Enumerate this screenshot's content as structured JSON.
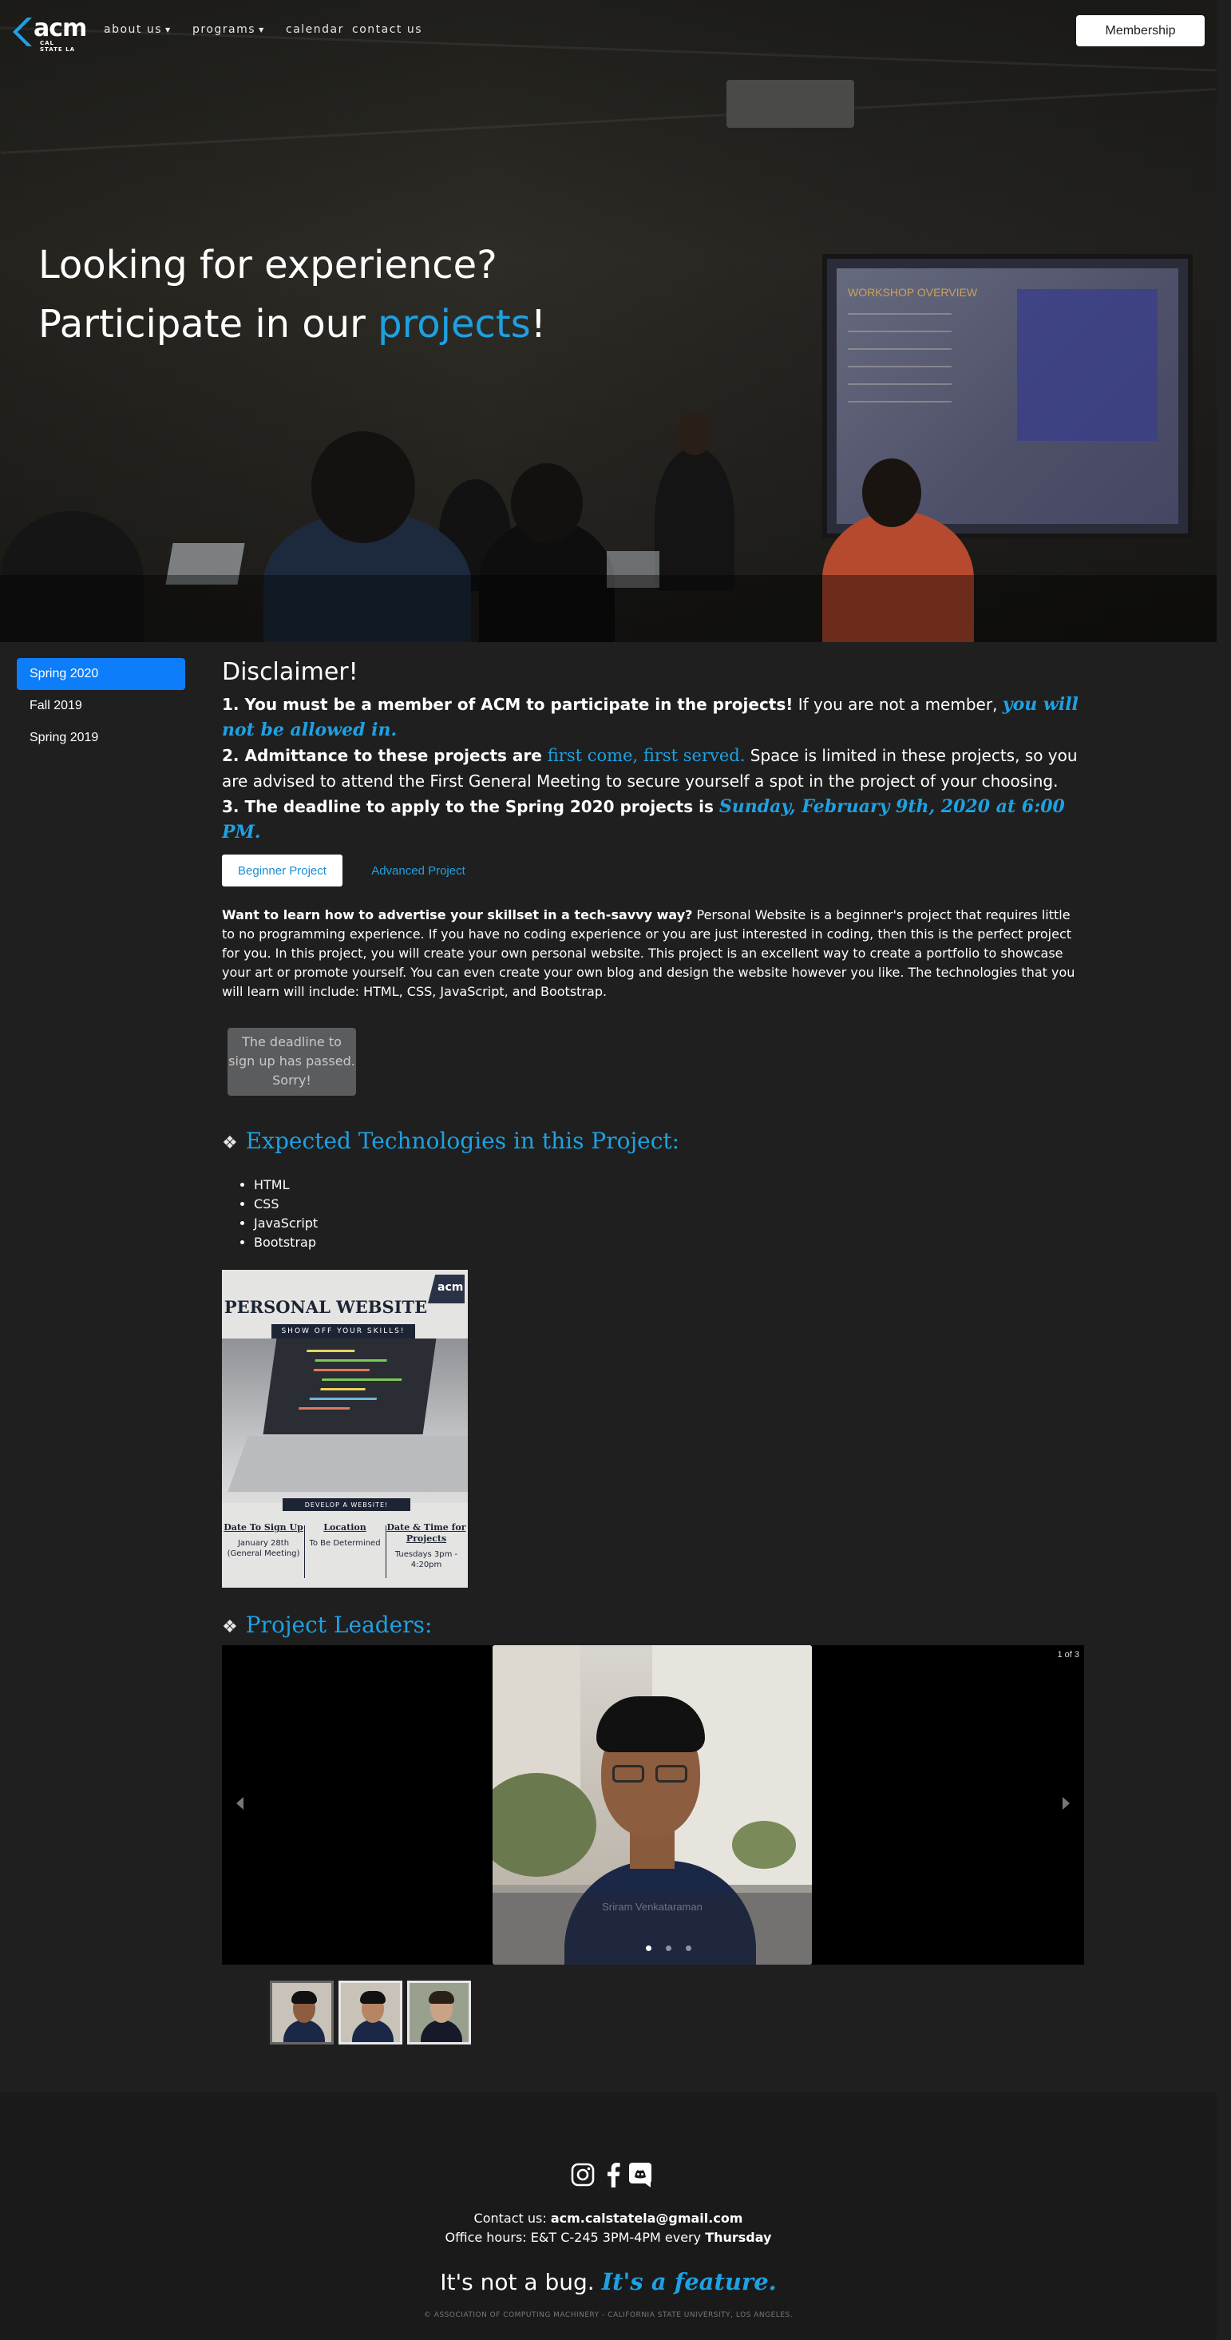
{
  "brand": {
    "logo_text": "acm",
    "logo_sub": "CAL STATE LA"
  },
  "nav": {
    "about": "about us",
    "programs": "programs",
    "calendar": "calendar",
    "contact": "contact us",
    "membership": "Membership"
  },
  "hero": {
    "line1": "Looking for experience?",
    "line2_prefix": "Participate in our ",
    "line2_accent": "projects",
    "line2_suffix": "!",
    "screen_title": "WORKSHOP OVERVIEW"
  },
  "sidebar": {
    "items": [
      {
        "label": "Spring 2020",
        "active": true
      },
      {
        "label": "Fall 2019",
        "active": false
      },
      {
        "label": "Spring 2019",
        "active": false
      }
    ]
  },
  "disclaimer": {
    "title": "Disclaimer!",
    "p1_bold": "1. You must be a member of ACM to participate in the projects!",
    "p1_text": " If you are not a member, ",
    "p1_accent": "you will not be allowed in.",
    "p2_bold": "2. Admittance to these projects are ",
    "p2_accent": "first come, first served.",
    "p2_text": " Space is limited in these projects, so you are advised to attend the First General Meeting to secure yourself a spot in the project of your choosing.",
    "p3_bold": "3. The deadline to apply to the Spring 2020 projects is ",
    "p3_accent": "Sunday, February 9th, 2020 at 6:00 PM."
  },
  "tabs": {
    "beginner": "Beginner Project",
    "advanced": "Advanced Project"
  },
  "project": {
    "desc_bold": "Want to learn how to advertise your skillset in a tech-savvy way?",
    "desc_text": " Personal Website is a beginner's project that requires little to no programming experience. If you have no coding experience or you are just interested in coding, then this is the perfect project for you. In this project, you will create your own personal website. This project is an excellent way to create a portfolio to showcase your art or promote yourself. You can even create your own blog and design the website however you like. The technologies that you will learn will include: HTML, CSS, JavaScript, and Bootstrap.",
    "deadline_button": "The deadline to sign up has passed. Sorry!",
    "tech_heading": "Expected Technologies in this Project:",
    "technologies": [
      "HTML",
      "CSS",
      "JavaScript",
      "Bootstrap"
    ],
    "leaders_heading": "Project Leaders:",
    "bullet": "❖"
  },
  "poster": {
    "title": "PERSONAL WEBSITE",
    "badge": "acm",
    "strip1": "SHOW OFF YOUR SKILLS!",
    "strip2": "DEVELOP A WEBSITE!",
    "col1_h": "Date To Sign Up",
    "col1_p": "January 28th (General Meeting)",
    "col2_h": "Location",
    "col2_p": "To Be Determined",
    "col3_h": "Date & Time for Projects",
    "col3_p": "Tuesdays 3pm - 4:20pm"
  },
  "carousel": {
    "counter": "1 of 3",
    "caption": "Sriram Venkataraman",
    "slides": 3,
    "active_index": 0
  },
  "footer": {
    "contact_label": "Contact us: ",
    "email": "acm.calstatela@gmail.com",
    "hours_prefix": "Office hours: E&T C-245 3PM-4PM every ",
    "hours_day": "Thursday",
    "tagline_plain": "It's not a bug. ",
    "tagline_accent": "It's a feature.",
    "copyright": "© ASSOCIATION OF COMPUTING MACHINERY - CALIFORNIA STATE UNIVERSITY, LOS ANGELES.",
    "icons": [
      "instagram-icon",
      "facebook-icon",
      "discord-icon"
    ]
  },
  "colors": {
    "accent": "#1ea1e2",
    "active_tab": "#0d7dfa",
    "background": "#1f1f1f"
  }
}
